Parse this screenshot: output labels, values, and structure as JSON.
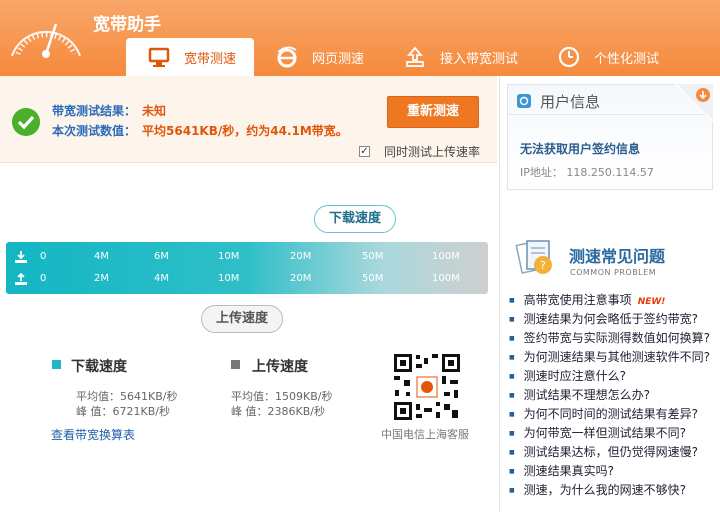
{
  "app": {
    "title": "宽带助手"
  },
  "tabs": [
    {
      "label": "宽带测速",
      "icon": "monitor-icon",
      "active": true
    },
    {
      "label": "网页测速",
      "icon": "ie-browser-icon",
      "active": false
    },
    {
      "label": "接入带宽测试",
      "icon": "upload-box-icon",
      "active": false
    },
    {
      "label": "个性化测试",
      "icon": "clock-icon",
      "active": false
    }
  ],
  "result": {
    "result_label": "带宽测试结果：",
    "result_value": "未知",
    "value_label": "本次测试数值：",
    "value_text": "平均5641KB/秒，约为44.1M带宽。",
    "retest_button": "重新测速",
    "upload_checkbox_label": "同时测试上传速率",
    "upload_checkbox_checked": true
  },
  "gauge": {
    "download_bubble": "下载速度",
    "upload_bubble": "上传速度",
    "download_ticks": [
      "0",
      "4M",
      "6M",
      "10M",
      "20M",
      "50M",
      "100M"
    ],
    "upload_ticks": [
      "0",
      "2M",
      "4M",
      "10M",
      "20M",
      "50M",
      "100M"
    ]
  },
  "stats": {
    "download": {
      "title": "下载速度",
      "avg": "平均值：5641KB/秒",
      "peak": "峰  值：6721KB/秒",
      "color": "#1fb7c4"
    },
    "upload": {
      "title": "上传速度",
      "avg": "平均值：1509KB/秒",
      "peak": "峰  值：2386KB/秒",
      "color": "#777777"
    },
    "convert_link": "查看带宽换算表",
    "qr_caption": "中国电信上海客服"
  },
  "user_info": {
    "title": "用户信息",
    "status": "无法获取用户签约信息",
    "ip": "IP地址：  118.250.114.57"
  },
  "faq": {
    "title": "测速常见问题",
    "subtitle": "COMMON PROBLEM",
    "new_badge": "NEW!",
    "items": [
      "高带宽使用注意事项",
      "测速结果为何会略低于签约带宽?",
      "签约带宽与实际测得数值如何换算?",
      "为何测速结果与其他测速软件不同?",
      "测速时应注意什么?",
      "测试结果不理想怎么办?",
      "为何不同时间的测试结果有差异?",
      "为何带宽一样但测试结果不同?",
      "测试结果达标，但仍觉得网速慢?",
      "测速结果真实吗?",
      "测速，为什么我的网速不够快?"
    ]
  },
  "colors": {
    "header": "#f58a3c",
    "accent": "#e2560a",
    "bar": "#13b6c3",
    "link": "#1f5fa8"
  }
}
